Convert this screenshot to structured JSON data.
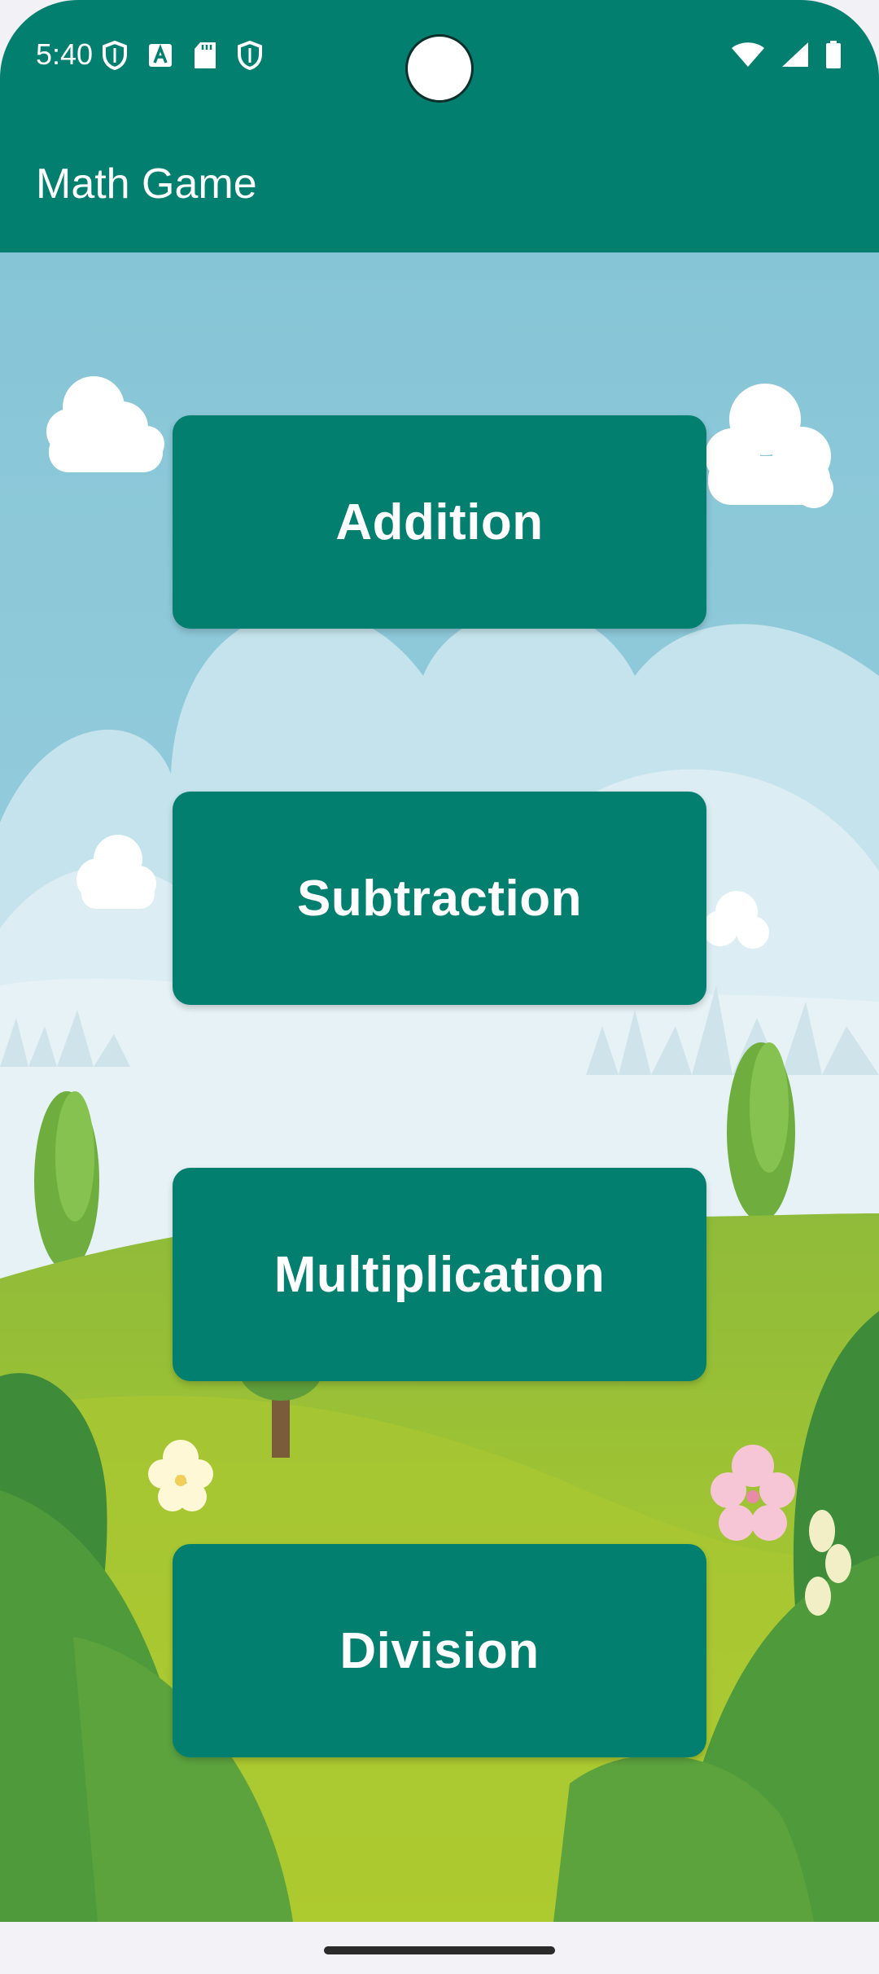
{
  "status_bar": {
    "time": "5:40",
    "left_icons": [
      "shield-icon",
      "text-a-icon",
      "sd-card-icon",
      "shield-icon"
    ],
    "right_icons": [
      "wifi-icon",
      "signal-icon",
      "battery-icon"
    ]
  },
  "app_bar": {
    "title": "Math Game"
  },
  "menu": {
    "buttons": [
      {
        "label": "Addition"
      },
      {
        "label": "Subtraction"
      },
      {
        "label": "Multiplication"
      },
      {
        "label": "Division"
      }
    ]
  },
  "colors": {
    "primary": "#037f70",
    "sky": "#8dc8d8",
    "grass": "#9cc23a",
    "foliage": "#3e8b3a"
  }
}
